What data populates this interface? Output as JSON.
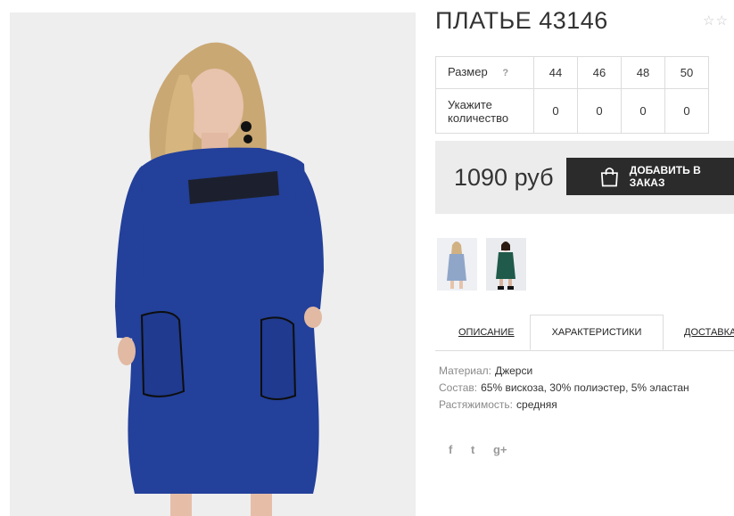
{
  "product": {
    "title": "ПЛАТЬЕ 43146",
    "rating_icons": "☆☆"
  },
  "sizes": {
    "size_label": "Размер",
    "help_mark": "?",
    "quantity_label_line1": "Укажите",
    "quantity_label_line2": "количество",
    "columns": [
      "44",
      "46",
      "48",
      "50"
    ],
    "quantities": [
      "0",
      "0",
      "0",
      "0"
    ]
  },
  "order": {
    "price": "1090 руб",
    "add_button_label": "ДОБАВИТЬ В ЗАКАЗ"
  },
  "tabs": {
    "description": "ОПИСАНИЕ",
    "characteristics": "ХАРАКТЕРИСТИКИ",
    "delivery": "ДОСТАВКА"
  },
  "specs": [
    {
      "key": "Материал:",
      "value": "Джерси"
    },
    {
      "key": "Состав:",
      "value": "65% вискоза, 30% полиэстер, 5% эластан"
    },
    {
      "key": "Растяжимость:",
      "value": "средняя"
    }
  ],
  "social": {
    "facebook": "f",
    "twitter": "t",
    "google": "g+"
  },
  "colors": {
    "dress_blue": "#23409a",
    "dress_green": "#1f5a4a",
    "thumb_light_blue": "#8fa6c9",
    "button_bg": "#2b2b2b",
    "price_bg": "#ececec"
  },
  "icons": {
    "bag": "shopping-bag-icon",
    "facebook": "facebook-icon",
    "twitter": "twitter-icon",
    "google": "google-plus-icon",
    "stars": "rating-star-icon"
  }
}
